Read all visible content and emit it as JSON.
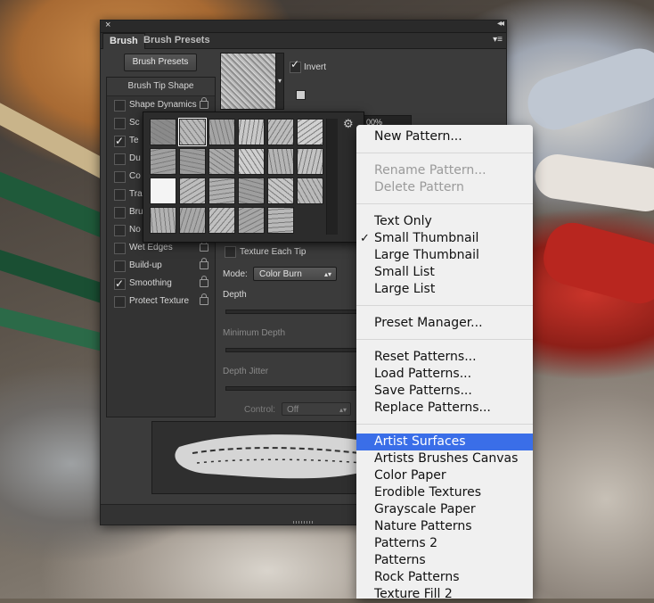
{
  "panel": {
    "tabs": [
      {
        "label": "Brush"
      },
      {
        "label": "Brush Presets"
      }
    ],
    "close_glyph": "×",
    "collapse_glyph": "◂◂",
    "menu_glyph": "▾≡",
    "presets_button": "Brush Presets",
    "list_header": "Brush Tip Shape",
    "items": [
      {
        "label": "Shape Dynamics",
        "checked": false
      },
      {
        "label": "Sc",
        "checked": false
      },
      {
        "label": "Te",
        "checked": true
      },
      {
        "label": "Du",
        "checked": false
      },
      {
        "label": "Co",
        "checked": false
      },
      {
        "label": "Tra",
        "checked": false
      },
      {
        "label": "Bru",
        "checked": false
      },
      {
        "label": "No",
        "checked": false
      },
      {
        "label": "Wet Edges",
        "checked": false
      },
      {
        "label": "Build-up",
        "checked": false
      },
      {
        "label": "Smoothing",
        "checked": true
      },
      {
        "label": "Protect Texture",
        "checked": false
      }
    ],
    "invert_label": "Invert",
    "scale_value": "00%",
    "texture_each_tip": "Texture Each Tip",
    "mode_label": "Mode:",
    "mode_value": "Color Burn",
    "depth_label": "Depth",
    "min_depth_label": "Minimum Depth",
    "depth_jitter_label": "Depth Jitter",
    "control_label": "Control:",
    "control_value": "Off"
  },
  "picker": {
    "gear_icon": "gear-icon",
    "swatch_count": 23
  },
  "menu": {
    "items": [
      {
        "label": "New Pattern...",
        "state": "normal"
      },
      {
        "label": "Rename Pattern...",
        "state": "disabled"
      },
      {
        "label": "Delete Pattern",
        "state": "disabled"
      },
      {
        "label": "Text Only",
        "state": "normal"
      },
      {
        "label": "Small Thumbnail",
        "state": "checked"
      },
      {
        "label": "Large Thumbnail",
        "state": "normal"
      },
      {
        "label": "Small List",
        "state": "normal"
      },
      {
        "label": "Large List",
        "state": "normal"
      },
      {
        "label": "Preset Manager...",
        "state": "normal"
      },
      {
        "label": "Reset Patterns...",
        "state": "normal"
      },
      {
        "label": "Load Patterns...",
        "state": "normal"
      },
      {
        "label": "Save Patterns...",
        "state": "normal"
      },
      {
        "label": "Replace Patterns...",
        "state": "normal"
      },
      {
        "label": "Artist Surfaces",
        "state": "highlighted"
      },
      {
        "label": "Artists Brushes Canvas",
        "state": "normal"
      },
      {
        "label": "Color Paper",
        "state": "normal"
      },
      {
        "label": "Erodible Textures",
        "state": "normal"
      },
      {
        "label": "Grayscale Paper",
        "state": "normal"
      },
      {
        "label": "Nature Patterns",
        "state": "normal"
      },
      {
        "label": "Patterns 2",
        "state": "normal"
      },
      {
        "label": "Patterns",
        "state": "normal"
      },
      {
        "label": "Rock Patterns",
        "state": "normal"
      },
      {
        "label": "Texture Fill 2",
        "state": "normal"
      }
    ],
    "check_glyph": "✓"
  }
}
